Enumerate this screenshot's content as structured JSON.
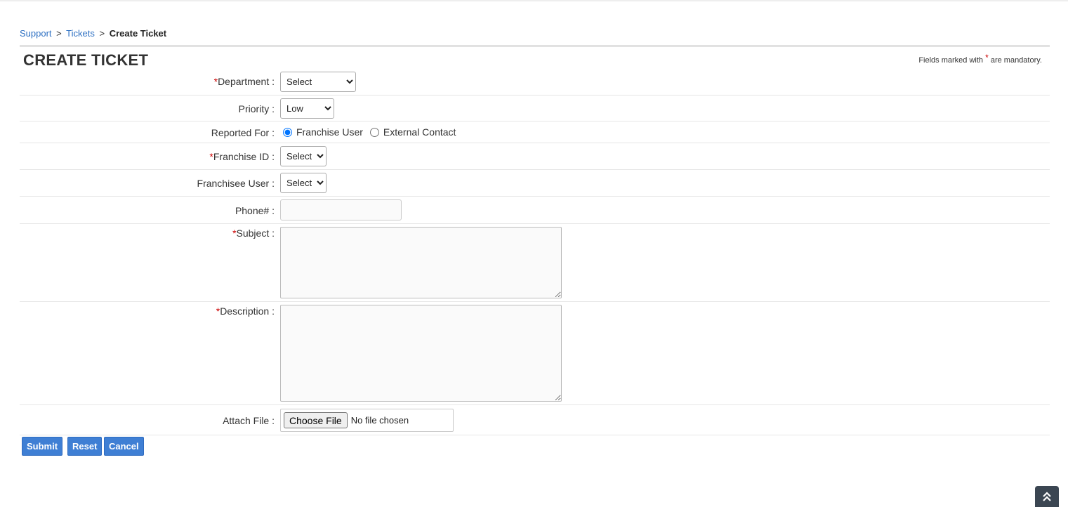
{
  "breadcrumb": {
    "support": "Support",
    "tickets": "Tickets",
    "current": "Create Ticket",
    "separator": ">"
  },
  "page_title": "CREATE TICKET",
  "mandatory_note": {
    "prefix": "Fields marked with",
    "star": "*",
    "suffix": "are mandatory."
  },
  "form": {
    "department": {
      "label": "Department :",
      "required": "*",
      "value": "Select"
    },
    "priority": {
      "label": "Priority :",
      "value": "Low"
    },
    "reported_for": {
      "label": "Reported For :",
      "options": [
        "Franchise User",
        "External Contact"
      ],
      "selected": "Franchise User"
    },
    "franchise_id": {
      "label": "Franchise ID :",
      "required": "*",
      "value": "Select"
    },
    "franchisee_user": {
      "label": "Franchisee User :",
      "value": "Select"
    },
    "phone": {
      "label": "Phone# :",
      "value": ""
    },
    "subject": {
      "label": "Subject :",
      "required": "*",
      "value": ""
    },
    "description": {
      "label": "Description :",
      "required": "*",
      "value": ""
    },
    "attach_file": {
      "label": "Attach File :",
      "button": "Choose File",
      "status": "No file chosen"
    }
  },
  "buttons": {
    "submit": "Submit",
    "reset": "Reset",
    "cancel": "Cancel"
  },
  "scroll_top_icon": "double-chevron-up-icon",
  "colors": {
    "link": "#2c6fc2",
    "button": "#3f7fd4",
    "required": "#cc0000"
  }
}
